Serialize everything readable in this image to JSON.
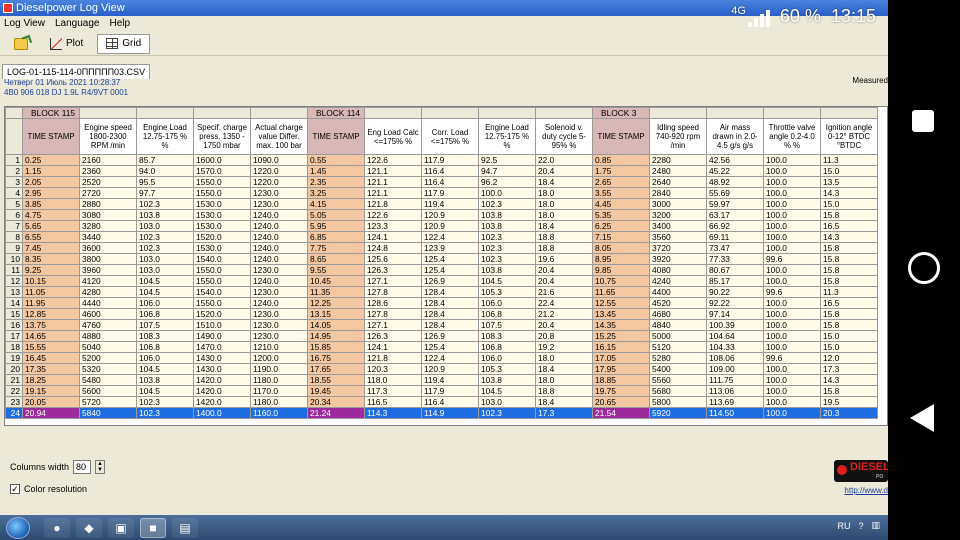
{
  "window": {
    "title": "Dieselpower Log View"
  },
  "menu": [
    "Log View",
    "Language",
    "Help"
  ],
  "toolbar": {
    "plot_label": "Plot",
    "grid_label": "Grid"
  },
  "file_tab": "LOG-01-115-114-0ППППП03.CSV",
  "info": {
    "date_line": "Четверг 01 Июль 2021 10:28:37",
    "vehicle_line": "4B0 906 018 DJ  1.9L R4/9VT        0001",
    "measured_label": "Measured"
  },
  "grid": {
    "blocks": [
      "BLOCK 115",
      "BLOCK 114",
      "BLOCK 3"
    ],
    "columns": [
      "TIME STAMP",
      "Engine speed 1800-2300 RPM /min",
      "Engine Load 12.75-175 % %",
      "Specif. charge press. 1350 - 1750 mbar",
      "Actual charge value Differ. max. 100 bar",
      "TIME STAMP",
      "Eng Load Calc <=175% %",
      "Corr. Load <=175% %",
      "Engine Load 12.75-175 % %",
      "Solenoid v. duty cycle 5-95% %",
      "TIME STAMP",
      "Idling speed 740-920 rpm /min",
      "Air mass drawn in 2.0-4.5 g/s g/s",
      "Throttle valve angle 0.2-4.0 % %",
      "Ignition angle 0-12° BTDC °BTDC"
    ],
    "rows": [
      [
        "0.25",
        "2160",
        "85.7",
        "1600.0",
        "1090.0",
        "0.55",
        "122.6",
        "117.9",
        "92.5",
        "22.0",
        "0.85",
        "2280",
        "42.56",
        "100.0",
        "11.3"
      ],
      [
        "1.15",
        "2360",
        "94.0",
        "1570.0",
        "1220.0",
        "1.45",
        "121.1",
        "116.4",
        "94.7",
        "20.4",
        "1.75",
        "2480",
        "45.22",
        "100.0",
        "15.0"
      ],
      [
        "2.05",
        "2520",
        "95.5",
        "1550.0",
        "1220.0",
        "2.35",
        "121.1",
        "116.4",
        "96.2",
        "18.4",
        "2.65",
        "2640",
        "48.92",
        "100.0",
        "13.5"
      ],
      [
        "2.95",
        "2720",
        "97.7",
        "1550.0",
        "1230.0",
        "3.25",
        "121.1",
        "117.9",
        "100.0",
        "18.0",
        "3.55",
        "2840",
        "55.69",
        "100.0",
        "14.3"
      ],
      [
        "3.85",
        "2880",
        "102.3",
        "1530.0",
        "1230.0",
        "4.15",
        "121.8",
        "119.4",
        "102.3",
        "18.0",
        "4.45",
        "3000",
        "59.97",
        "100.0",
        "15.0"
      ],
      [
        "4.75",
        "3080",
        "103.8",
        "1530.0",
        "1240.0",
        "5.05",
        "122.6",
        "120.9",
        "103.8",
        "18.0",
        "5.35",
        "3200",
        "63.17",
        "100.0",
        "15.8"
      ],
      [
        "5.65",
        "3280",
        "103.0",
        "1530.0",
        "1240.0",
        "5.95",
        "123.3",
        "120.9",
        "103.8",
        "18.4",
        "6.25",
        "3400",
        "66.92",
        "100.0",
        "16.5"
      ],
      [
        "6.55",
        "3440",
        "102.3",
        "1520.0",
        "1240.0",
        "6.85",
        "124.1",
        "122.4",
        "102.3",
        "18.8",
        "7.15",
        "3560",
        "69.11",
        "100.0",
        "14.3"
      ],
      [
        "7.45",
        "3600",
        "102.3",
        "1530.0",
        "1240.0",
        "7.75",
        "124.8",
        "123.9",
        "102.3",
        "18.8",
        "8.05",
        "3720",
        "73.47",
        "100.0",
        "15.8"
      ],
      [
        "8.35",
        "3800",
        "103.0",
        "1540.0",
        "1240.0",
        "8.65",
        "125.6",
        "125.4",
        "102.3",
        "19.6",
        "8.95",
        "3920",
        "77.33",
        "99.6",
        "15.8"
      ],
      [
        "9.25",
        "3960",
        "103.0",
        "1550.0",
        "1230.0",
        "9.55",
        "126.3",
        "125.4",
        "103.8",
        "20.4",
        "9.85",
        "4080",
        "80.67",
        "100.0",
        "15.8"
      ],
      [
        "10.15",
        "4120",
        "104.5",
        "1550.0",
        "1240.0",
        "10.45",
        "127.1",
        "126.9",
        "104.5",
        "20.4",
        "10.75",
        "4240",
        "85.17",
        "100.0",
        "15.8"
      ],
      [
        "11.05",
        "4280",
        "104.5",
        "1540.0",
        "1230.0",
        "11.35",
        "127.8",
        "128.4",
        "105.3",
        "21.6",
        "11.65",
        "4400",
        "90.22",
        "99.6",
        "11.3"
      ],
      [
        "11.95",
        "4440",
        "106.0",
        "1550.0",
        "1240.0",
        "12.25",
        "128.6",
        "128.4",
        "106.0",
        "22.4",
        "12.55",
        "4520",
        "92.22",
        "100.0",
        "16.5"
      ],
      [
        "12.85",
        "4600",
        "106.8",
        "1520.0",
        "1230.0",
        "13.15",
        "127.8",
        "128.4",
        "106.8",
        "21.2",
        "13.45",
        "4680",
        "97.14",
        "100.0",
        "15.8"
      ],
      [
        "13.75",
        "4760",
        "107.5",
        "1510.0",
        "1230.0",
        "14.05",
        "127.1",
        "128.4",
        "107.5",
        "20.4",
        "14.35",
        "4840",
        "100.39",
        "100.0",
        "15.8"
      ],
      [
        "14.65",
        "4880",
        "108.3",
        "1490.0",
        "1230.0",
        "14.95",
        "126.3",
        "126.9",
        "108.3",
        "20.8",
        "15.25",
        "5000",
        "104.64",
        "100.0",
        "15.0"
      ],
      [
        "15.55",
        "5040",
        "106.8",
        "1470.0",
        "1210.0",
        "15.85",
        "124.1",
        "125.4",
        "106.8",
        "19.2",
        "16.15",
        "5120",
        "104.33",
        "100.0",
        "15.0"
      ],
      [
        "16.45",
        "5200",
        "106.0",
        "1430.0",
        "1200.0",
        "16.75",
        "121.8",
        "122.4",
        "106.0",
        "18.0",
        "17.05",
        "5280",
        "108.06",
        "99.6",
        "12.0"
      ],
      [
        "17.35",
        "5320",
        "104.5",
        "1430.0",
        "1190.0",
        "17.65",
        "120.3",
        "120.9",
        "105.3",
        "18.4",
        "17.95",
        "5400",
        "109.00",
        "100.0",
        "17.3"
      ],
      [
        "18.25",
        "5480",
        "103.8",
        "1420.0",
        "1180.0",
        "18.55",
        "118.0",
        "119.4",
        "103.8",
        "18.0",
        "18.85",
        "5560",
        "111.75",
        "100.0",
        "14.3"
      ],
      [
        "19.15",
        "5600",
        "104.5",
        "1420.0",
        "1170.0",
        "19.45",
        "117.3",
        "117.9",
        "104.5",
        "18.8",
        "19.75",
        "5680",
        "113.06",
        "100.0",
        "15.8"
      ],
      [
        "20.05",
        "5720",
        "102.3",
        "1420.0",
        "1180.0",
        "20.34",
        "116.5",
        "116.4",
        "103.0",
        "18.4",
        "20.65",
        "5800",
        "113.69",
        "100.0",
        "19.5"
      ],
      [
        "20.94",
        "5840",
        "102.3",
        "1400.0",
        "1160.0",
        "21.24",
        "114.3",
        "114.9",
        "102.3",
        "17.3",
        "21.54",
        "5920",
        "114.50",
        "100.0",
        "20.3"
      ]
    ]
  },
  "bottom": {
    "columns_width_label": "Columns width",
    "columns_width_value": "80",
    "color_resolution_label": "Color resolution",
    "logo_text": "DIESEL",
    "logo_sub": "PO",
    "url": "http://www.d"
  },
  "status": {
    "network": "4G",
    "battery": "60 %",
    "time": "13:15"
  },
  "taskbar": {
    "lang": "RU"
  },
  "colors": {
    "timestamp": "#f4c7a0",
    "block_header": "#d8b7b7",
    "cell_bg": "#fffbe8",
    "selection": "#1e6de0"
  }
}
